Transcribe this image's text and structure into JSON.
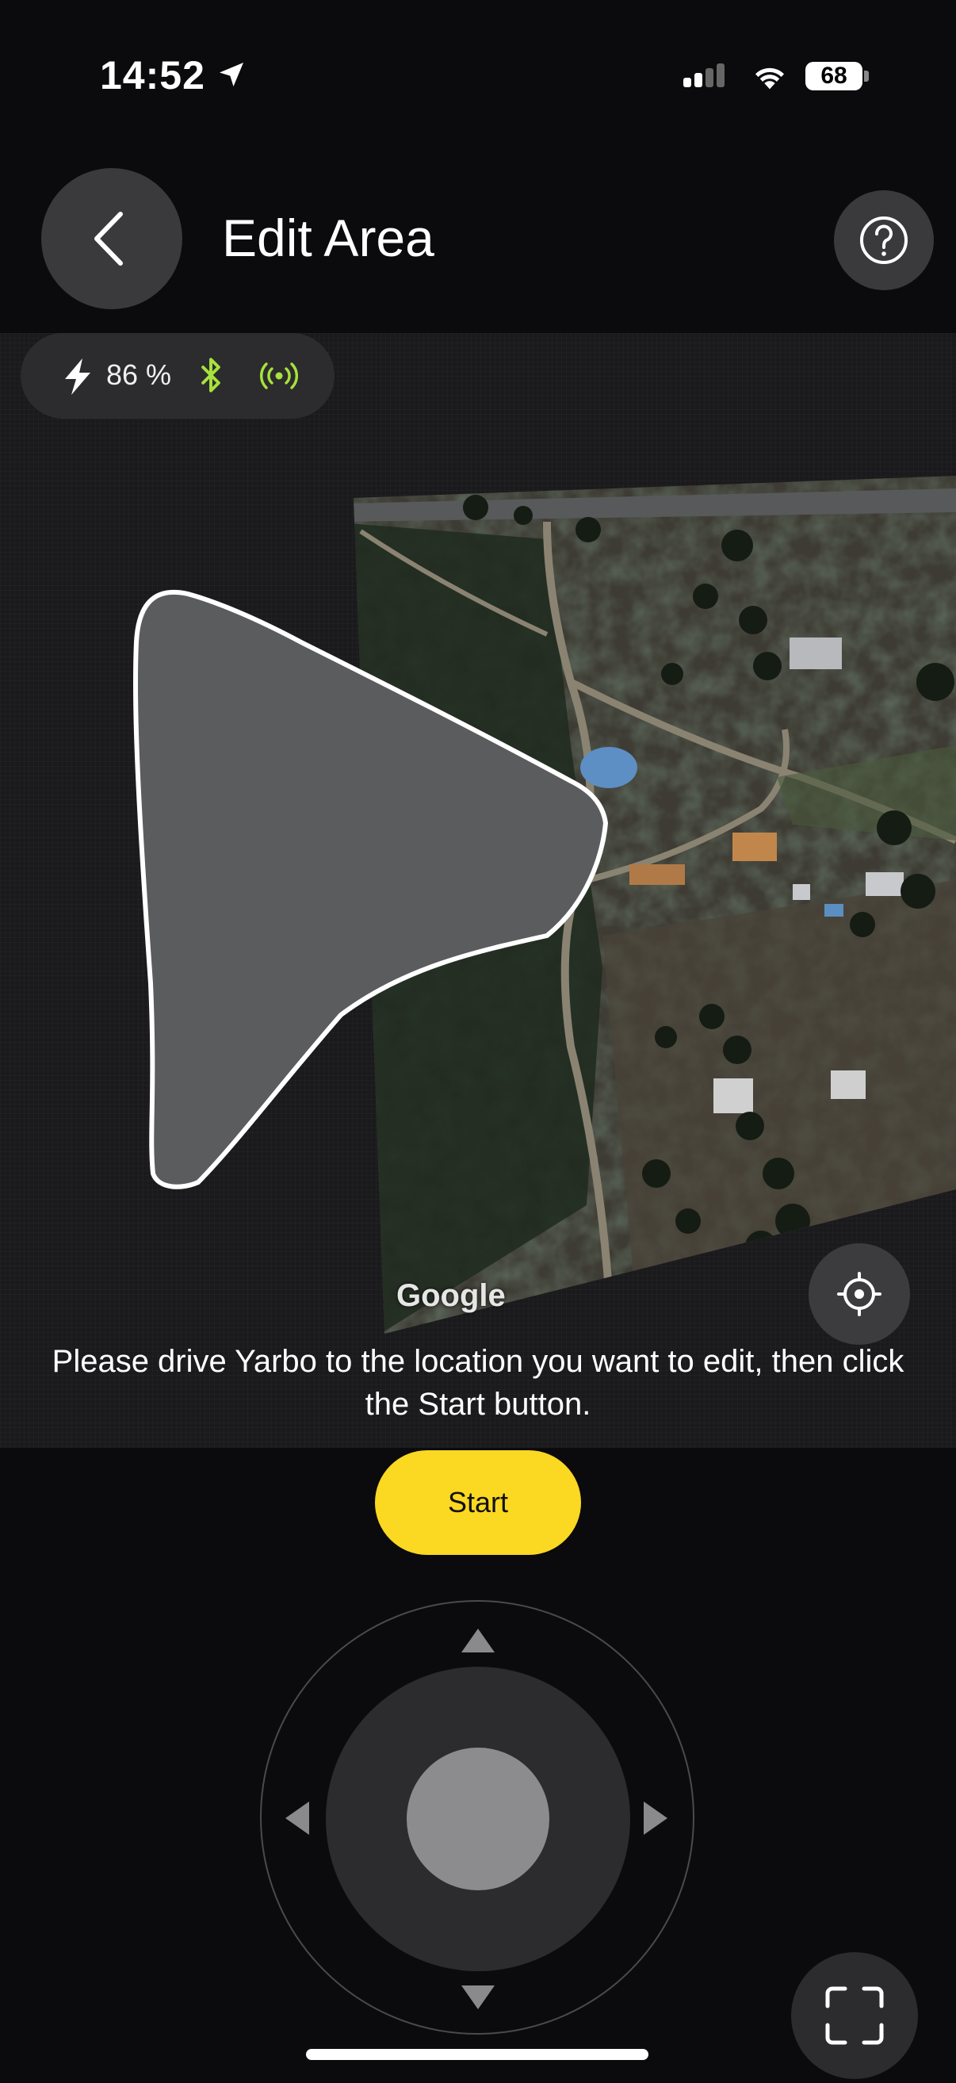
{
  "status_bar": {
    "time": "14:52",
    "battery_level": "68",
    "icons": [
      "location-arrow-icon",
      "cellular-signal-icon",
      "wifi-icon",
      "battery-icon"
    ]
  },
  "header": {
    "title": "Edit Area",
    "back_icon": "chevron-left-icon",
    "help_icon": "question-circle-icon"
  },
  "device_status": {
    "battery": "86 %",
    "icons": [
      "charging-bolt-icon",
      "bluetooth-icon",
      "signal-broadcast-icon"
    ],
    "accent_color": "#a8e23c"
  },
  "map": {
    "attribution": "Google",
    "locate_icon": "crosshair-locate-icon"
  },
  "instruction": "Please drive Yarbo to the location you want to edit, then click the Start button.",
  "start_button": {
    "label": "Start",
    "color": "#fbd822"
  },
  "joystick": {
    "icons": [
      "arrow-up-icon",
      "arrow-down-icon",
      "arrow-left-icon",
      "arrow-right-icon"
    ]
  },
  "fullscreen_icon": "fullscreen-icon"
}
